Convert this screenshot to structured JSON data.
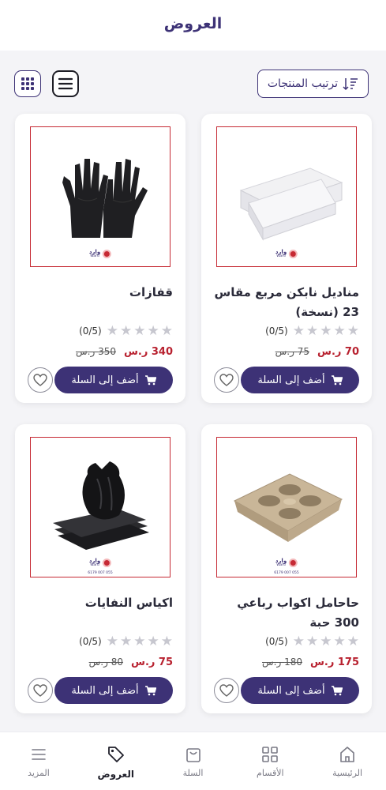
{
  "header": {
    "title": "العروض"
  },
  "toolbar": {
    "sort_label": "ترتيب المنتجات"
  },
  "currency": "ر.س",
  "brand": {
    "name_ar": "وارد",
    "name_en": "Ward",
    "phone": "055 007 6179"
  },
  "rating_text": "(0/5)",
  "add_to_cart_label": "أضف إلى السلة",
  "products": [
    {
      "name": "مناديل نابكن مربع مقاس 23 (نسخة)",
      "price": "70 ر.س",
      "old_price": "75 ر.س",
      "rating": 0,
      "image": "napkins"
    },
    {
      "name": "قفازات",
      "price": "340 ر.س",
      "old_price": "350 ر.س",
      "rating": 0,
      "image": "gloves"
    },
    {
      "name": "حاحامل اكواب رباعي    300 حبة",
      "price": "175 ر.س",
      "old_price": "180 ر.س",
      "rating": 0,
      "image": "cup-holder"
    },
    {
      "name": "اكياس النفايات",
      "price": "75 ر.س",
      "old_price": "80 ر.س",
      "rating": 0,
      "image": "garbage-bags"
    }
  ],
  "nav": [
    {
      "label": "الرئيسية",
      "icon": "home-icon",
      "active": false
    },
    {
      "label": "الأقسام",
      "icon": "categories-icon",
      "active": false
    },
    {
      "label": "السلة",
      "icon": "bag-icon",
      "active": false
    },
    {
      "label": "العروض",
      "icon": "tag-icon",
      "active": true
    },
    {
      "label": "المزيد",
      "icon": "menu-icon",
      "active": false
    }
  ],
  "colors": {
    "primary": "#3d3276",
    "price": "#b8212f",
    "frame": "#c62a34",
    "star_empty": "#c7c7cf"
  }
}
